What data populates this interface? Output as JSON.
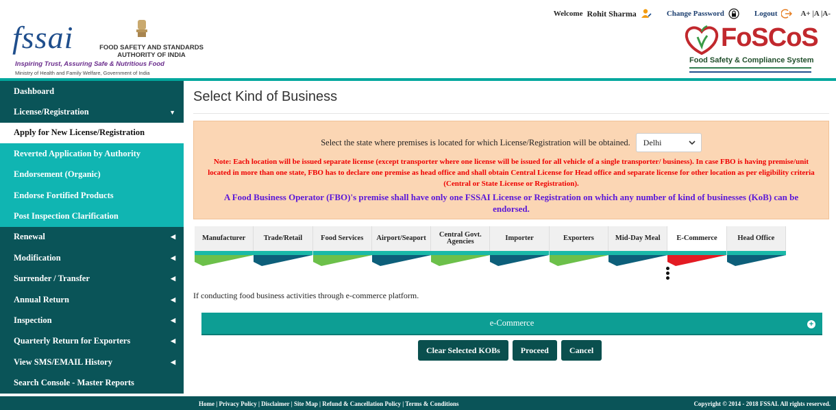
{
  "header": {
    "fssai_word": "fssai",
    "authority_line1": "FOOD SAFETY AND STANDARDS",
    "authority_line2": "AUTHORITY OF INDIA",
    "tagline": "Inspiring Trust, Assuring Safe & Nutritious Food",
    "ministry": "Ministry of Health and Family Welfare, Government of India",
    "welcome_label": "Welcome",
    "user_name": "Rohit Sharma",
    "change_password": "Change Password",
    "logout": "Logout",
    "font_sizes": "A+ |A |A-",
    "foscos_title": "FoSCoS",
    "foscos_subtitle": "Food Safety & Compliance System"
  },
  "sidebar": {
    "items": [
      {
        "label": "Dashboard",
        "style": "dark",
        "caret": ""
      },
      {
        "label": "License/Registration",
        "style": "dark",
        "caret": "▼"
      },
      {
        "label": "Apply for New License/Registration",
        "style": "active",
        "caret": ""
      },
      {
        "label": "Reverted Application by Authority",
        "style": "sub",
        "caret": ""
      },
      {
        "label": "Endorsement (Organic)",
        "style": "sub",
        "caret": ""
      },
      {
        "label": "Endorse Fortified Products",
        "style": "sub",
        "caret": ""
      },
      {
        "label": "Post Inspection Clarification",
        "style": "sub",
        "caret": ""
      },
      {
        "label": "Renewal",
        "style": "dark",
        "caret": "◀"
      },
      {
        "label": "Modification",
        "style": "dark",
        "caret": "◀"
      },
      {
        "label": "Surrender / Transfer",
        "style": "dark",
        "caret": "◀"
      },
      {
        "label": "Annual Return",
        "style": "dark",
        "caret": "◀"
      },
      {
        "label": "Inspection",
        "style": "dark",
        "caret": "◀"
      },
      {
        "label": "Quarterly Return for Exporters",
        "style": "dark",
        "caret": "◀"
      },
      {
        "label": "View SMS/EMAIL History",
        "style": "dark",
        "caret": "◀"
      },
      {
        "label": "Search Console - Master Reports",
        "style": "dark",
        "caret": ""
      }
    ]
  },
  "main": {
    "title": "Select Kind of Business",
    "state_prompt": "Select the state where premises is located for which License/Registration will be obtained.",
    "state_value": "Delhi",
    "note": "Note: Each location will be issued separate license (except transporter where one license will be issued for all vehicle of a single transporter/ business). In case FBO is having premise/unit located in more than one state, FBO has to declare one premise as head office and shall obtain Central License for Head office and separate license for other location as per eligibility criteria (Central or State License or Registration).",
    "info": "A Food Business Operator (FBO)'s premise shall have only one FSSAI License or Registration on which any number of kind of businesses (KoB) can be endorsed.",
    "tabs": [
      {
        "label": "Manufacturer",
        "color": "green"
      },
      {
        "label": "Trade/Retail",
        "color": "blue"
      },
      {
        "label": "Food Services",
        "color": "green"
      },
      {
        "label": "Airport/Seaport",
        "color": "blue"
      },
      {
        "label": "Central Govt. Agencies",
        "color": "green"
      },
      {
        "label": "Importer",
        "color": "blue"
      },
      {
        "label": "Exporters",
        "color": "green"
      },
      {
        "label": "Mid-Day Meal",
        "color": "blue"
      },
      {
        "label": "E-Commerce",
        "color": "red"
      },
      {
        "label": "Head Office",
        "color": "blue"
      }
    ],
    "selected_tab": "E-Commerce",
    "description": "If conducting food business activities through e-commerce platform.",
    "accordion_label": "e-Commerce",
    "buttons": {
      "clear": "Clear Selected KOBs",
      "proceed": "Proceed",
      "cancel": "Cancel"
    }
  },
  "footer": {
    "links": "Home | Privacy Policy | Disclaimer | Site Map | Refund & Cancellation Policy | Terms & Conditions",
    "copyright": "Copyright © 2014 - 2018 FSSAI. All rights reserved."
  },
  "colors": {
    "teal": "#00a79d",
    "dark_teal": "#0a5458",
    "sub_teal": "#10b5b2",
    "green": "#6cc04a",
    "blue": "#0d5f7a",
    "red": "#e31b23",
    "notice_bg": "#fbd6b4"
  }
}
